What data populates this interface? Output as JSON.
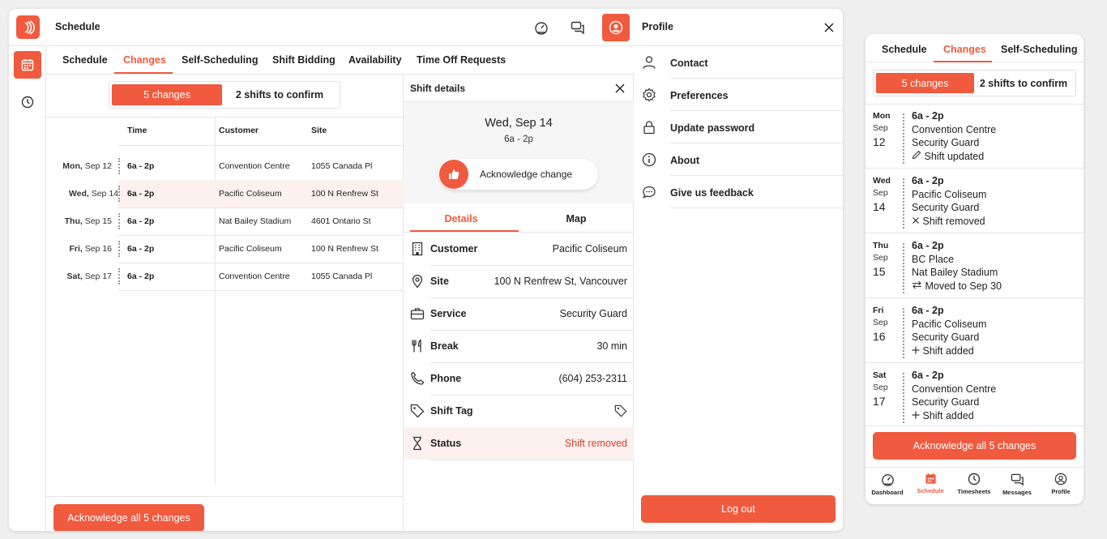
{
  "app": {
    "title": "Schedule",
    "tabs": [
      "Schedule",
      "Changes",
      "Self-Scheduling",
      "Shift Bidding",
      "Availability",
      "Time Off Requests"
    ],
    "active_tab": "Changes"
  },
  "list": {
    "segment_changes": "5 changes",
    "segment_confirm": "2 shifts to confirm",
    "columns": {
      "time": "Time",
      "customer": "Customer",
      "site": "Site"
    },
    "rows": [
      {
        "day": "Mon,",
        "date": "Sep 12",
        "time": "6a - 2p",
        "customer": "Convention Centre",
        "site": "1055 Canada Pl"
      },
      {
        "day": "Wed,",
        "date": "Sep 14",
        "time": "6a - 2p",
        "customer": "Pacific Coliseum",
        "site": "100 N Renfrew St"
      },
      {
        "day": "Thu,",
        "date": "Sep 15",
        "time": "6a - 2p",
        "customer": "Nat Bailey Stadium",
        "site": "4601 Ontario St"
      },
      {
        "day": "Fri,",
        "date": "Sep 16",
        "time": "6a - 2p",
        "customer": "Pacific Coliseum",
        "site": "100 N Renfrew St"
      },
      {
        "day": "Sat,",
        "date": "Sep 17",
        "time": "6a - 2p",
        "customer": "Convention Centre",
        "site": "1055 Canada Pl"
      }
    ],
    "acknowledge_all": "Acknowledge all 5 changes"
  },
  "shift_details": {
    "header": "Shift details",
    "date": "Wed, Sep 14",
    "time": "6a - 2p",
    "ack_label": "Acknowledge change",
    "tab_details": "Details",
    "tab_map": "Map",
    "customer_label": "Customer",
    "customer_value": "Pacific Coliseum",
    "site_label": "Site",
    "site_value": "100 N Renfrew St, Vancouver",
    "service_label": "Service",
    "service_value": "Security Guard",
    "break_label": "Break",
    "break_value": "30 min",
    "phone_label": "Phone",
    "phone_value": "(604) 253-2311",
    "tag_label": "Shift Tag",
    "status_label": "Status",
    "status_value": "Shift removed"
  },
  "profile": {
    "title": "Profile",
    "items": [
      "Contact",
      "Preferences",
      "Update password",
      "About",
      "Give us feedback"
    ],
    "logout": "Log out"
  },
  "mobile": {
    "tabs": [
      "Schedule",
      "Changes",
      "Self-Scheduling"
    ],
    "segment_changes": "5 changes",
    "segment_confirm": "2 shifts to confirm",
    "cards": [
      {
        "dow": "Mon",
        "mon": "Sep",
        "day": "12",
        "time": "6a - 2p",
        "customer": "Convention Centre",
        "service": "Security Guard",
        "change": "Shift updated"
      },
      {
        "dow": "Wed",
        "mon": "Sep",
        "day": "14",
        "time": "6a - 2p",
        "customer": "Pacific Coliseum",
        "service": "Security Guard",
        "change": "Shift removed"
      },
      {
        "dow": "Thu",
        "mon": "Sep",
        "day": "15",
        "time": "6a - 2p",
        "customer": "BC Place",
        "service": "Nat Bailey Stadium",
        "change": "Moved to Sep 30"
      },
      {
        "dow": "Fri",
        "mon": "Sep",
        "day": "16",
        "time": "6a - 2p",
        "customer": "Pacific Coliseum",
        "service": "Security Guard",
        "change": "Shift added"
      },
      {
        "dow": "Sat",
        "mon": "Sep",
        "day": "17",
        "time": "6a - 2p",
        "customer": "Convention Centre",
        "service": "Security Guard",
        "change": "Shift added"
      }
    ],
    "acknowledge_all": "Acknowledge all 5 changes",
    "nav": [
      "Dashboard",
      "Schedule",
      "Timesheets",
      "Messages",
      "Profile"
    ]
  },
  "colors": {
    "accent": "#f05a3e",
    "highlight_row": "#fdf1ef"
  }
}
